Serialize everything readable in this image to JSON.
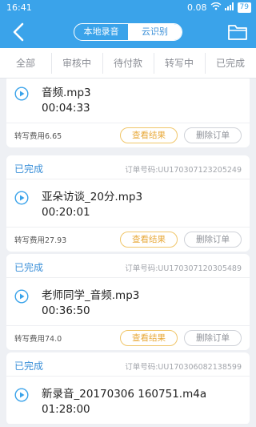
{
  "statusbar": {
    "time": "16:41",
    "speed": "0.08",
    "battery": "79"
  },
  "header": {
    "segments": [
      "本地录音",
      "云识别"
    ],
    "active_segment": "云识别"
  },
  "tabs": [
    "全部",
    "审核中",
    "待付款",
    "转写中",
    "已完成"
  ],
  "orders": [
    {
      "status": "",
      "order_label": "",
      "order_no": "",
      "file_name": "音频.mp3",
      "duration": "00:04:33",
      "fee_label": "转写费用",
      "fee": "6.65",
      "view_label": "查看结果",
      "delete_label": "删除订单"
    },
    {
      "status": "已完成",
      "order_label": "订单号码:",
      "order_no": "UU170307123205249",
      "file_name": "亚朵访谈_20分.mp3",
      "duration": "00:20:01",
      "fee_label": "转写费用",
      "fee": "27.93",
      "view_label": "查看结果",
      "delete_label": "删除订单"
    },
    {
      "status": "已完成",
      "order_label": "订单号码:",
      "order_no": "UU170307120305489",
      "file_name": "老师同学_音频.mp3",
      "duration": "00:36:50",
      "fee_label": "转写费用",
      "fee": "74.0",
      "view_label": "查看结果",
      "delete_label": "删除订单"
    },
    {
      "status": "已完成",
      "order_label": "订单号码:",
      "order_no": "UU170306082138599",
      "file_name": "新录音_20170306 160751.m4a",
      "duration": "01:28:00",
      "fee_label": "",
      "fee": "",
      "view_label": "",
      "delete_label": ""
    }
  ],
  "colors": {
    "accent": "#3aa3ea",
    "status": "#3a8fd8",
    "view_button": "#e8a93a"
  }
}
